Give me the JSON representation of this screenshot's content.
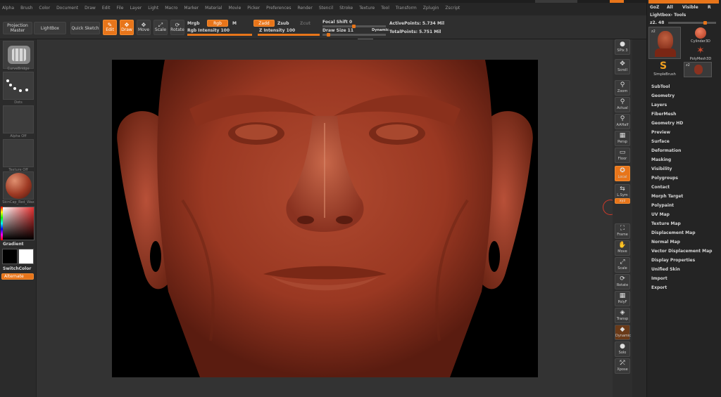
{
  "menu": {
    "items": [
      "Alpha",
      "Brush",
      "Color",
      "Document",
      "Draw",
      "Edit",
      "File",
      "Layer",
      "Light",
      "Macro",
      "Marker",
      "Material",
      "Movie",
      "Picker",
      "Preferences",
      "Render",
      "Stencil",
      "Stroke",
      "Texture",
      "Tool",
      "Transform",
      "Zplugin",
      "Zscript"
    ],
    "quicksave": "QuickSave"
  },
  "shelf": {
    "projection_master": "Projection Master",
    "lightbox": "LightBox",
    "quick_sketch": "Quick Sketch",
    "edit": "Edit",
    "draw": "Draw",
    "move": "Move",
    "scale": "Scale",
    "rotate": "Rotate",
    "mrgb": "Mrgb",
    "rgb": "Rgb",
    "m": "M",
    "rgb_intensity": "Rgb Intensity 100",
    "zadd": "Zadd",
    "zsub": "Zsub",
    "zcut": "Zcut",
    "z_intensity": "Z Intensity 100",
    "focal_shift": "Focal Shift 0",
    "draw_size": "Draw Size 11",
    "dynamic": "Dynamic",
    "active_points": "ActivePoints: 5.734 Mil",
    "total_points": "TotalPoints: 5.751 Mil",
    "rgb_intensity_level": 100,
    "z_intensity_level": 100,
    "draw_size_level": 11
  },
  "left": {
    "brush_caption": "CurveBridge",
    "stroke_caption": "Dots",
    "alpha_caption": "Alpha Off",
    "texture_caption": "Texture Off",
    "material_caption": "SkinCap_Red_Wax",
    "gradient": "Gradient",
    "switch_color": "SwitchColor",
    "alternate": "Alternate"
  },
  "rtools": [
    {
      "name": "spix",
      "icon": "●",
      "label": "SPix 3"
    },
    {
      "name": "scroll",
      "icon": "✥",
      "label": "Scroll"
    },
    {
      "name": "zoom",
      "icon": "⚲",
      "label": "Zoom"
    },
    {
      "name": "actual",
      "icon": "⚲",
      "label": "Actual"
    },
    {
      "name": "aahalf",
      "icon": "⚲",
      "label": "AAHalf"
    },
    {
      "name": "persp",
      "icon": "▦",
      "label": "Persp"
    },
    {
      "name": "floor",
      "icon": "▭",
      "label": "Floor"
    },
    {
      "name": "local",
      "icon": "✪",
      "label": "Local"
    },
    {
      "name": "lsym",
      "icon": "⇆",
      "label": "L.Sym"
    },
    {
      "name": "xyz",
      "icon": "xyz",
      "label": ""
    },
    {
      "name": "frame",
      "icon": "⛶",
      "label": "Frame"
    },
    {
      "name": "move",
      "icon": "✋",
      "label": "Move"
    },
    {
      "name": "scale",
      "icon": "⤢",
      "label": "Scale"
    },
    {
      "name": "rotate",
      "icon": "⟳",
      "label": "Rotate"
    },
    {
      "name": "polyf",
      "icon": "▦",
      "label": "PolyF"
    },
    {
      "name": "transp",
      "icon": "◈",
      "label": "Transp"
    },
    {
      "name": "dynamic",
      "icon": "◆",
      "label": "Dynamic"
    },
    {
      "name": "solo",
      "icon": "●",
      "label": "Solo"
    },
    {
      "name": "xpose",
      "icon": "⤱",
      "label": "Xpose"
    }
  ],
  "rpanel": {
    "goz": "GoZ",
    "all": "All",
    "visible": "Visible",
    "r": "R",
    "lightbox_tools": "Lightbox› Tools",
    "z2_label": "z2. 48",
    "tools": {
      "t1": "z2",
      "t2": "Cylinder3D",
      "t3": "PolyMesh3D",
      "t4": "SimpleBrush",
      "t5": "z2"
    },
    "menu_items": [
      "SubTool",
      "Geometry",
      "Layers",
      "FiberMesh",
      "Geometry HD",
      "Preview",
      "Surface",
      "Deformation",
      "Masking",
      "Visibility",
      "Polygroups",
      "Contact",
      "Morph Target",
      "Polypaint",
      "UV Map",
      "Texture Map",
      "Displacement Map",
      "Normal Map",
      "Vector Displacement Map",
      "Display Properties",
      "Unified Skin",
      "Import",
      "Export"
    ]
  },
  "colors": {
    "accent": "#e8751a",
    "skin": "#9e3a24"
  }
}
